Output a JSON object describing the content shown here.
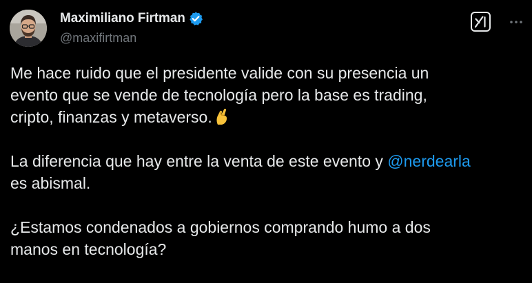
{
  "author": {
    "display_name": "Maximiliano Firtman",
    "handle": "@maxifirtman",
    "verified": true,
    "avatar_icon": "profile-photo"
  },
  "actions": {
    "grok_icon": "grok-icon",
    "more_icon": "more-horizontal-icon"
  },
  "tweet": {
    "line1": "Me hace ruido que el presidente valide con su presencia un",
    "line2": "evento que se vende de tecnología pero la base es trading,",
    "line3": "cripto, finanzas y metaverso.",
    "line3_emoji": "pinching-hand-emoji",
    "line4_before": "La diferencia que hay entre la venta de este evento y ",
    "mention": "@nerdearla",
    "line5": "es abismal.",
    "line6": "¿Estamos condenados a gobiernos comprando humo a dos",
    "line7": "manos en tecnología?"
  },
  "colors": {
    "background": "#000000",
    "text": "#e7e9ea",
    "secondary": "#71767b",
    "accent": "#1d9bf0"
  }
}
